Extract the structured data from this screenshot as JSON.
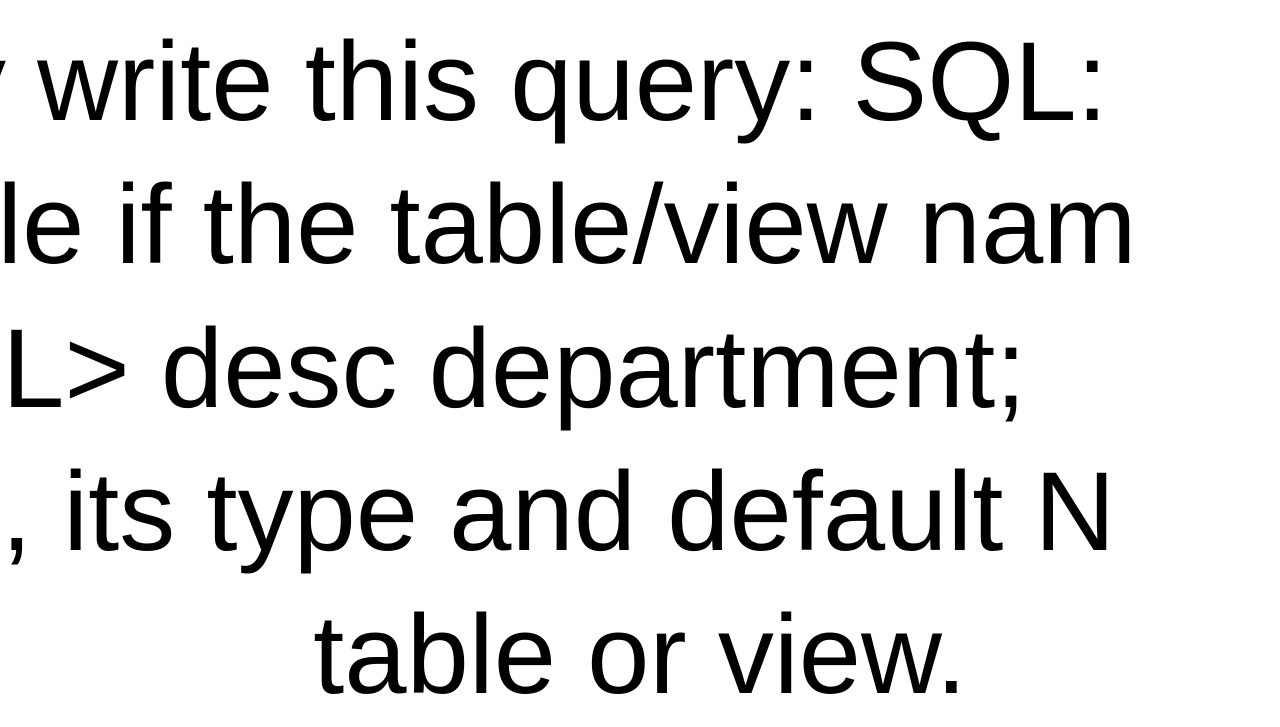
{
  "lines": {
    "l1": "y write this query: SQL:",
    "l2": "ple if the table/view nam",
    "l3": "QL> desc department;",
    "l4": "s, its type and default N",
    "l5": "table or view."
  }
}
